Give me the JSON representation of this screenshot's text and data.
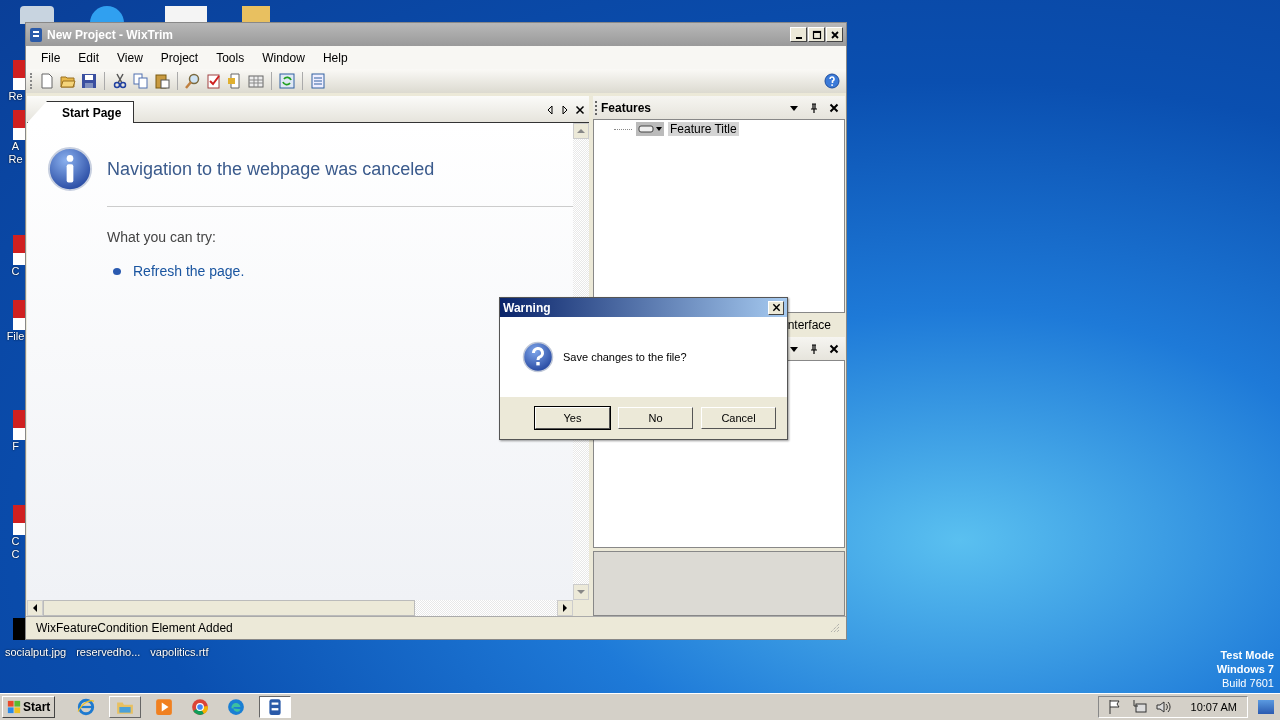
{
  "desktop": {
    "icons": [
      {
        "lines": [
          "Re"
        ]
      },
      {
        "lines": [
          "A",
          "Re"
        ]
      },
      {
        "lines": [
          "C"
        ]
      },
      {
        "lines": [
          "File"
        ]
      },
      {
        "lines": [
          "F"
        ]
      },
      {
        "lines": [
          "C",
          "C"
        ]
      }
    ],
    "files": [
      {
        "label": "socialput.jpg"
      },
      {
        "label": "reservedho..."
      },
      {
        "label": "vapolitics.rtf"
      }
    ],
    "os_notice": [
      "Test Mode",
      "Windows 7",
      "Build 7601"
    ]
  },
  "window": {
    "title": "New Project - WixTrim",
    "menu": [
      "File",
      "Edit",
      "View",
      "Project",
      "Tools",
      "Window",
      "Help"
    ],
    "tabs": [
      {
        "label": "Start Page",
        "selected": true
      }
    ],
    "start_page": {
      "heading": "Navigation to the webpage was canceled",
      "subheading": "What you can try:",
      "links": [
        "Refresh the page."
      ]
    },
    "features_panel": {
      "title": "Features",
      "tree": [
        {
          "label": "Feature Title",
          "selected": true
        }
      ]
    },
    "second_panel": {
      "tab_label": "nterface"
    },
    "status_bar": "WixFeatureCondition Element Added"
  },
  "dialog": {
    "title": "Warning",
    "message": "Save changes to the file?",
    "buttons": [
      {
        "label": "Yes",
        "default": true
      },
      {
        "label": "No",
        "default": false
      },
      {
        "label": "Cancel",
        "default": false
      }
    ]
  },
  "taskbar": {
    "start": "Start",
    "apps": [
      {
        "kind": "ie",
        "selected": false
      },
      {
        "kind": "explorer",
        "selected": false
      },
      {
        "kind": "media",
        "selected": false
      },
      {
        "kind": "chrome",
        "selected": false
      },
      {
        "kind": "edge",
        "selected": false
      },
      {
        "kind": "wixtrim",
        "selected": true
      }
    ],
    "time": "10:07 AM"
  }
}
